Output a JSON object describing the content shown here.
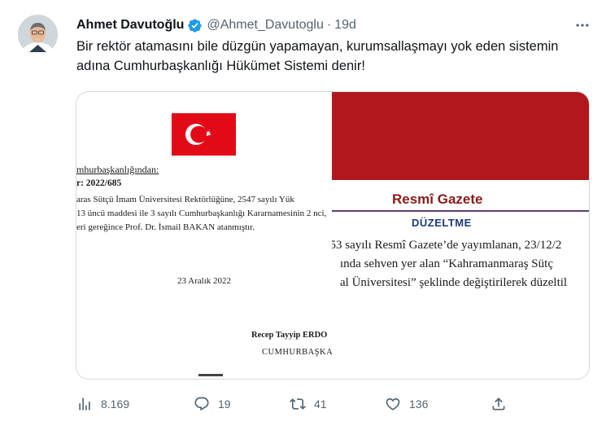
{
  "tweet": {
    "author_name": "Ahmet Davutoğlu",
    "handle": "@Ahmet_Davutoglu",
    "separator": "·",
    "time": "19d",
    "text": "Bir rektör atamasını bile düzgün yapamayan, kurumsallaşmayı yok eden sistemin adına Cumhurbaşkanlığı Hükümet Sistemi denir!"
  },
  "media": {
    "left_doc": {
      "line1": "mhurbaşkanlığından:",
      "line2": "r: 2022/685",
      "line3": "aras Sütçü İmam Üniversitesi Rektörlüğüne, 2547 sayılı Yük",
      "line4": "13 üncü maddesi ile 3 sayılı Cumhurbaşkanlığı Kararnamesinin 2 nci,",
      "line5": "eri gereğince Prof. Dr. İsmail BAKAN atanmıştır.",
      "date": "23 Aralık 2022",
      "signature": "Recep Tayyip ERDO",
      "signature_title": "CUMHURBAŞKA"
    },
    "right_doc": {
      "title": "Resmî Gazete",
      "heading": "DÜZELTME",
      "line1": "053 sayılı Resmî Gazete’de yayımlanan, 23/12/2",
      "line2": "ında sehven yer alan “Kahramanmaraş Sütç",
      "line3": "al Üniversitesi” şeklinde değiştirilerek düzeltil"
    }
  },
  "actions": {
    "views": "8.169",
    "replies": "19",
    "retweets": "41",
    "likes": "136"
  },
  "icons": {
    "verified": "verified-badge-icon",
    "more": "more-horizontal-icon",
    "views": "analytics-icon",
    "reply": "reply-icon",
    "retweet": "retweet-icon",
    "like": "heart-icon",
    "share": "share-icon"
  },
  "colors": {
    "text_primary": "#0f1419",
    "text_secondary": "#536471",
    "verified_blue": "#1d9bf0",
    "flag_red": "#e30a17",
    "gazete_red": "#b2171c"
  }
}
